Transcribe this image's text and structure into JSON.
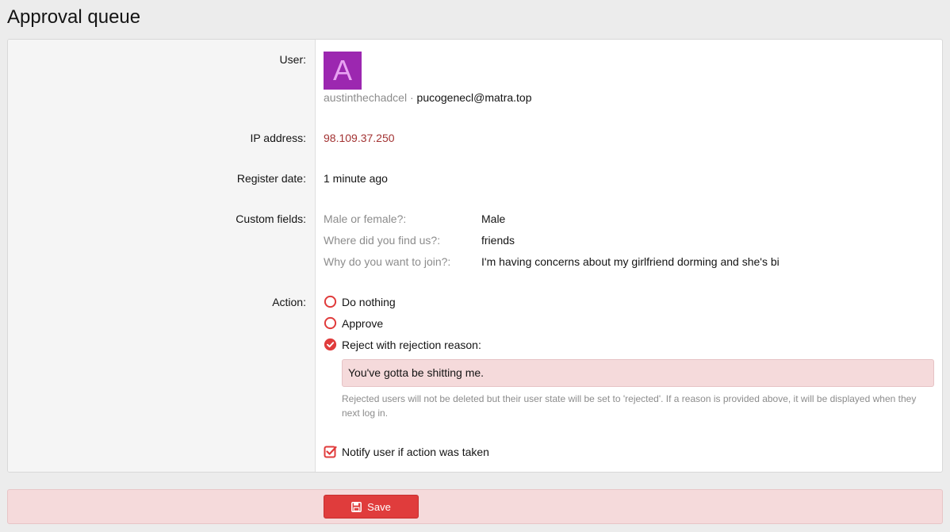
{
  "page": {
    "title": "Approval queue"
  },
  "user": {
    "label": "User:",
    "avatar_letter": "A",
    "username": "austinthechadcel",
    "separator": "·",
    "email": "pucogenecl@matra.top"
  },
  "ip": {
    "label": "IP address:",
    "value": "98.109.37.250"
  },
  "register": {
    "label": "Register date:",
    "value": "1 minute ago"
  },
  "custom_fields": {
    "label": "Custom fields:",
    "items": [
      {
        "key": "Male or female?:",
        "value": "Male"
      },
      {
        "key": "Where did you find us?:",
        "value": "friends"
      },
      {
        "key": "Why do you want to join?:",
        "value": "I'm having concerns about my girlfriend dorming and she's bi"
      }
    ]
  },
  "action": {
    "label": "Action:",
    "options": [
      {
        "label": "Do nothing",
        "selected": false
      },
      {
        "label": "Approve",
        "selected": false
      },
      {
        "label": "Reject with rejection reason:",
        "selected": true
      }
    ],
    "reason_value": "You've gotta be shitting me.",
    "hint": "Rejected users will not be deleted but their user state will be set to 'rejected'. If a reason is provided above, it will be displayed when they next log in.",
    "notify_label": "Notify user if action was taken",
    "notify_checked": true
  },
  "footer": {
    "save_label": "Save"
  },
  "colors": {
    "accent": "#e03c3c",
    "avatar_bg": "#9c27b0",
    "ip": "#a33333"
  }
}
